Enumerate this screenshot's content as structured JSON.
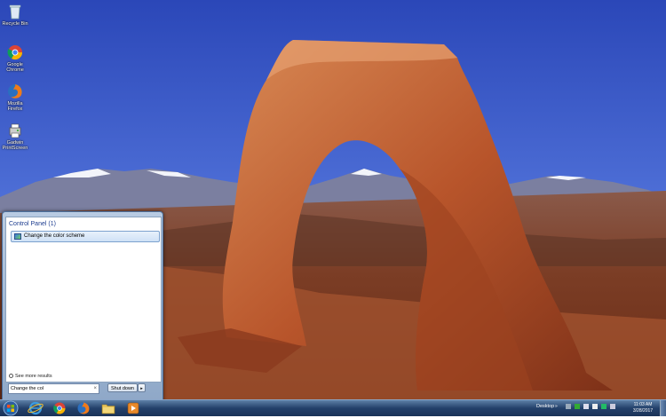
{
  "desktop_icons": [
    {
      "label": "Recycle Bin",
      "icon": "recycle-bin-icon"
    },
    {
      "label": "Google Chrome",
      "icon": "chrome-icon"
    },
    {
      "label": "Mozilla Firefox",
      "icon": "firefox-icon"
    },
    {
      "label": "Gadwin PrintScreen",
      "icon": "printscreen-icon"
    }
  ],
  "start_menu": {
    "group_header": "Control Panel (1)",
    "result_item": "Change the color scheme",
    "see_more": "See more results",
    "search_value": "Change the col",
    "shutdown_label": "Shut down",
    "shutdown_arrow": "▸",
    "clear_glyph": "×"
  },
  "taskbar": {
    "start_orb": "windows-orb-icon",
    "pinned": [
      "internet-explorer-icon",
      "chrome-icon",
      "firefox-icon",
      "explorer-folder-icon",
      "media-player-icon"
    ],
    "toolbar_label": "Desktop",
    "toolbar_chevron": "»",
    "clock_time": "11:03 AM",
    "clock_date": "3/28/2017"
  }
}
